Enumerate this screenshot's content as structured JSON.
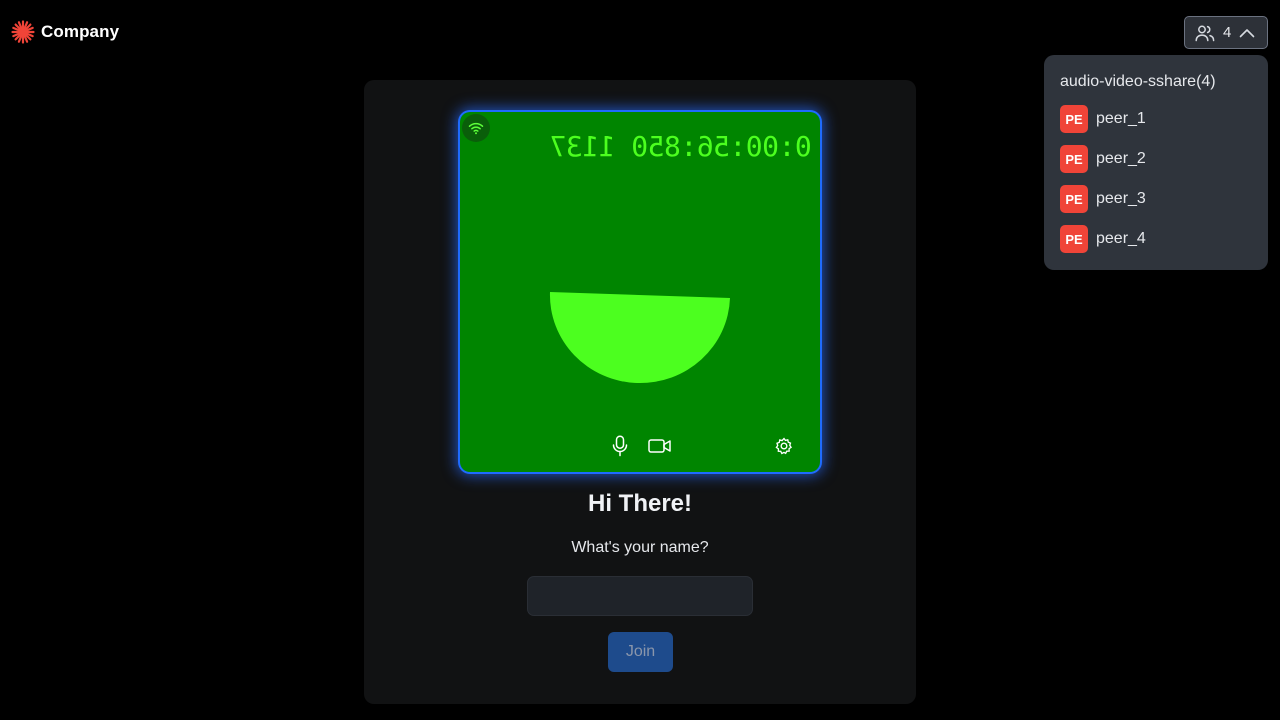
{
  "brand": {
    "name": "Company",
    "accent_color": "#f04438"
  },
  "header": {
    "participants_icon": "users-icon",
    "participants_count": "4",
    "toggle_icon": "chevron-up-icon"
  },
  "participants_panel": {
    "title": "audio-video-sshare(4)",
    "peers": [
      {
        "initials": "PE",
        "name": "peer_1"
      },
      {
        "initials": "PE",
        "name": "peer_2"
      },
      {
        "initials": "PE",
        "name": "peer_3"
      },
      {
        "initials": "PE",
        "name": "peer_4"
      }
    ]
  },
  "preview": {
    "timer_text": "0:00:56:850 1137",
    "network_icon": "wifi-icon",
    "controls": [
      {
        "name": "microphone-icon"
      },
      {
        "name": "camera-icon"
      },
      {
        "name": "settings-icon"
      }
    ],
    "tile_color": "#008500",
    "border_color": "#1f6bff"
  },
  "join_form": {
    "greeting": "Hi There!",
    "prompt": "What's your name?",
    "name_value": "",
    "join_label": "Join"
  }
}
